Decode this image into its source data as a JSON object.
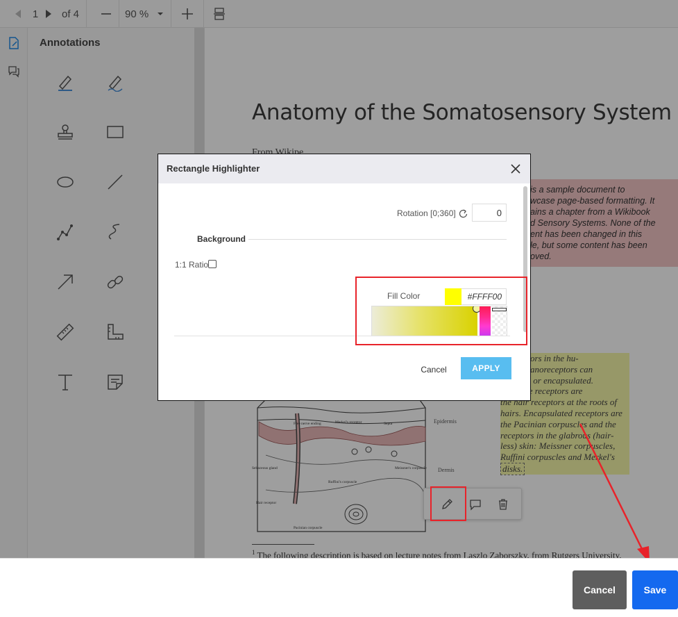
{
  "toolbar": {
    "page_current": "1",
    "page_total": "of 4",
    "zoom": "90 %"
  },
  "annotations_panel": {
    "title": "Annotations",
    "tools": [
      "highlight-pen",
      "freehand-pen",
      "stamp",
      "rectangle",
      "ellipse",
      "line",
      "polyline",
      "freehand-curve",
      "arrow",
      "link",
      "ruler",
      "area-measure",
      "text",
      "sticky-note"
    ]
  },
  "document": {
    "title": "Anatomy of the Somatosensory System",
    "author_partial": "From Wikipe",
    "pink_note_lines": [
      "is a sample document to",
      "wcase page-based formatting. It",
      "ains a chapter from a Wikibook",
      "d Sensory Systems. None of the",
      "ent has been changed in this",
      "le, but some content has been",
      "oved."
    ],
    "yellow_note_lines": [
      ": Receptors in the hu-",
      "n: Mechanoreceptors can",
      "eceptors or encapsulated.",
      "s for free receptors are",
      "the hair receptors at the roots of",
      "hairs. Encapsulated receptors are",
      "the Pacinian corpuscles and the",
      "receptors in the glabrous (hair-",
      "less) skin: Meissner corpuscles,",
      "Ruffini corpuscles and Merkel's",
      "disks."
    ],
    "figure_labels": {
      "free_nerve_ending": "Free nerve ending",
      "merkels_receptor": "Merkel's receptor",
      "septa": "Septa",
      "epidermis": "Epidermis",
      "dermis": "Dermis",
      "meissners_corpuscle": "Meissner's corpuscle",
      "ruffinis_corpuscle": "Ruffini's corpuscle",
      "sebaceous_gland": "Sebaceous gland",
      "hair_receptor": "Hair receptor",
      "pacinian_corpuscle": "Pacinian corpuscle"
    },
    "footnote_mark": "1",
    "footnote": "The following description is based on lecture notes from Laszlo Zaborszky, from Rutgers University."
  },
  "dialog": {
    "title": "Rectangle Highlighter",
    "rotation_label": "Rotation [0;360]",
    "rotation_value": "0",
    "background_section": "Background",
    "ratio_label": "1:1 Ratio",
    "fill_color_label": "Fill Color",
    "fill_color_hex": "#FFFF00",
    "cancel_label": "Cancel",
    "apply_label": "APPLY"
  },
  "colors": {
    "fill_color": "#ffff00",
    "apply_button": "#58bdf0",
    "save_button": "#1469ef",
    "cancel_button": "#5e5e5e",
    "annotation_red": "#e8232a"
  },
  "footer": {
    "cancel_label": "Cancel",
    "save_label": "Save"
  }
}
